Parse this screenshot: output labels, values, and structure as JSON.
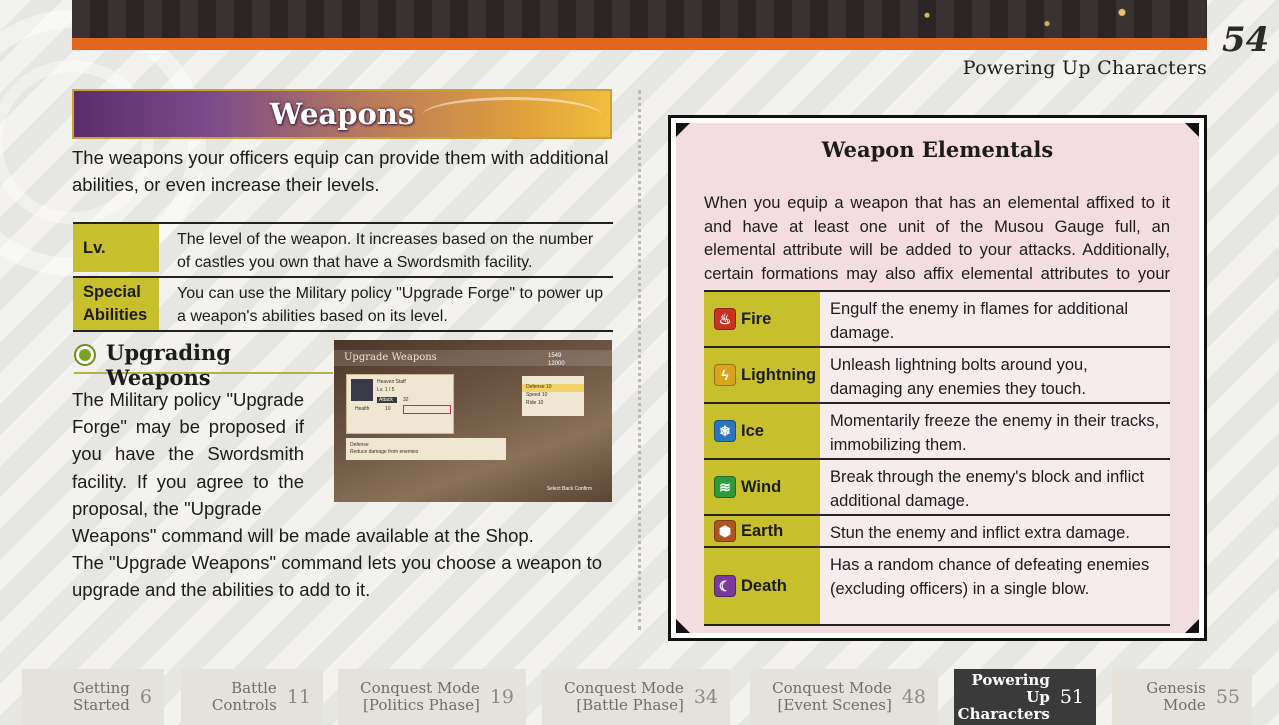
{
  "header": {
    "page_number": "54",
    "section": "Powering Up Characters"
  },
  "weapons": {
    "title": "Weapons",
    "intro": "The weapons your officers equip can provide them with additional abilities, or even increase their levels.",
    "table": [
      {
        "key": "Lv.",
        "value": "The level of the weapon. It increases based on the number of castles you own that have a Swordsmith facility."
      },
      {
        "key": "Special Abilities",
        "value": "You can use the Military policy \"Upgrade Forge\" to power up a weapon's abilities based on its level."
      }
    ]
  },
  "upgrading": {
    "heading": "Upgrading Weapons",
    "para_wrap": "The Military policy \"Upgrade Forge\" may be proposed if you have the Swordsmith facility. If you agree to the proposal, the \"Upgrade",
    "para_rest": "Weapons\" command will be made available at the Shop.",
    "para2": "The \"Upgrade Weapons\" command lets you choose a weapon to upgrade and the abilities to add to it."
  },
  "screenshot": {
    "title": "Upgrade Weapons",
    "gold1": "1549",
    "gold2": "12000",
    "weapon_name": "Heaven Staff",
    "weapon_level": "Lv. 1  /  5",
    "attack_label": "Attack",
    "attack_value": "32",
    "health_label": "Health",
    "health_value": "10",
    "stats": [
      {
        "label": "Defense",
        "value": "10"
      },
      {
        "label": "Speed",
        "value": "10"
      },
      {
        "label": "Ride",
        "value": "10"
      }
    ],
    "desc_title": "Defense",
    "desc_text": "Reduce damage from enemies",
    "footer": "Select   Back   Confirm"
  },
  "elementals": {
    "title": "Weapon Elementals",
    "description": "When you equip a weapon that has an elemental affixed to it and have at least one unit of the Musou Gauge full, an elemental attribute will be added to your attacks. Additionally, certain formations may also affix elemental attributes to your attacks.",
    "rows": [
      {
        "name": "Fire",
        "icon": "fire-icon",
        "color": "#c8321e",
        "glyph": "♨",
        "text": "Engulf the enemy in flames for additional damage."
      },
      {
        "name": "Lightning",
        "icon": "lightning-icon",
        "color": "#d9a51c",
        "glyph": "ϟ",
        "text": "Unleash lightning bolts around you, damaging any enemies they touch."
      },
      {
        "name": "Ice",
        "icon": "ice-icon",
        "color": "#2a74c0",
        "glyph": "❄",
        "text": "Momentarily freeze the enemy in their tracks, immobilizing them."
      },
      {
        "name": "Wind",
        "icon": "wind-icon",
        "color": "#2e9a3c",
        "glyph": "≋",
        "text": "Break through the enemy's block and inflict additional damage."
      },
      {
        "name": "Earth",
        "icon": "earth-icon",
        "color": "#b0541e",
        "glyph": "⬢",
        "text": "Stun the enemy and inflict extra damage."
      },
      {
        "name": "Death",
        "icon": "death-icon",
        "color": "#7a3a9a",
        "glyph": "☾",
        "text": "Has a random chance of defeating enemies (excluding officers) in a single blow."
      }
    ]
  },
  "nav": [
    {
      "line1": "Getting",
      "line2": "Started",
      "page": "6"
    },
    {
      "line1": "Battle",
      "line2": "Controls",
      "page": "11"
    },
    {
      "line1": "Conquest Mode",
      "line2": "[Politics Phase]",
      "page": "19"
    },
    {
      "line1": "Conquest Mode",
      "line2": "[Battle Phase]",
      "page": "34"
    },
    {
      "line1": "Conquest Mode",
      "line2": "[Event Scenes]",
      "page": "48"
    },
    {
      "line1": "Powering Up",
      "line2": "Characters",
      "page": "51",
      "active": true
    },
    {
      "line1": "Genesis",
      "line2": "Mode",
      "page": "55"
    }
  ]
}
